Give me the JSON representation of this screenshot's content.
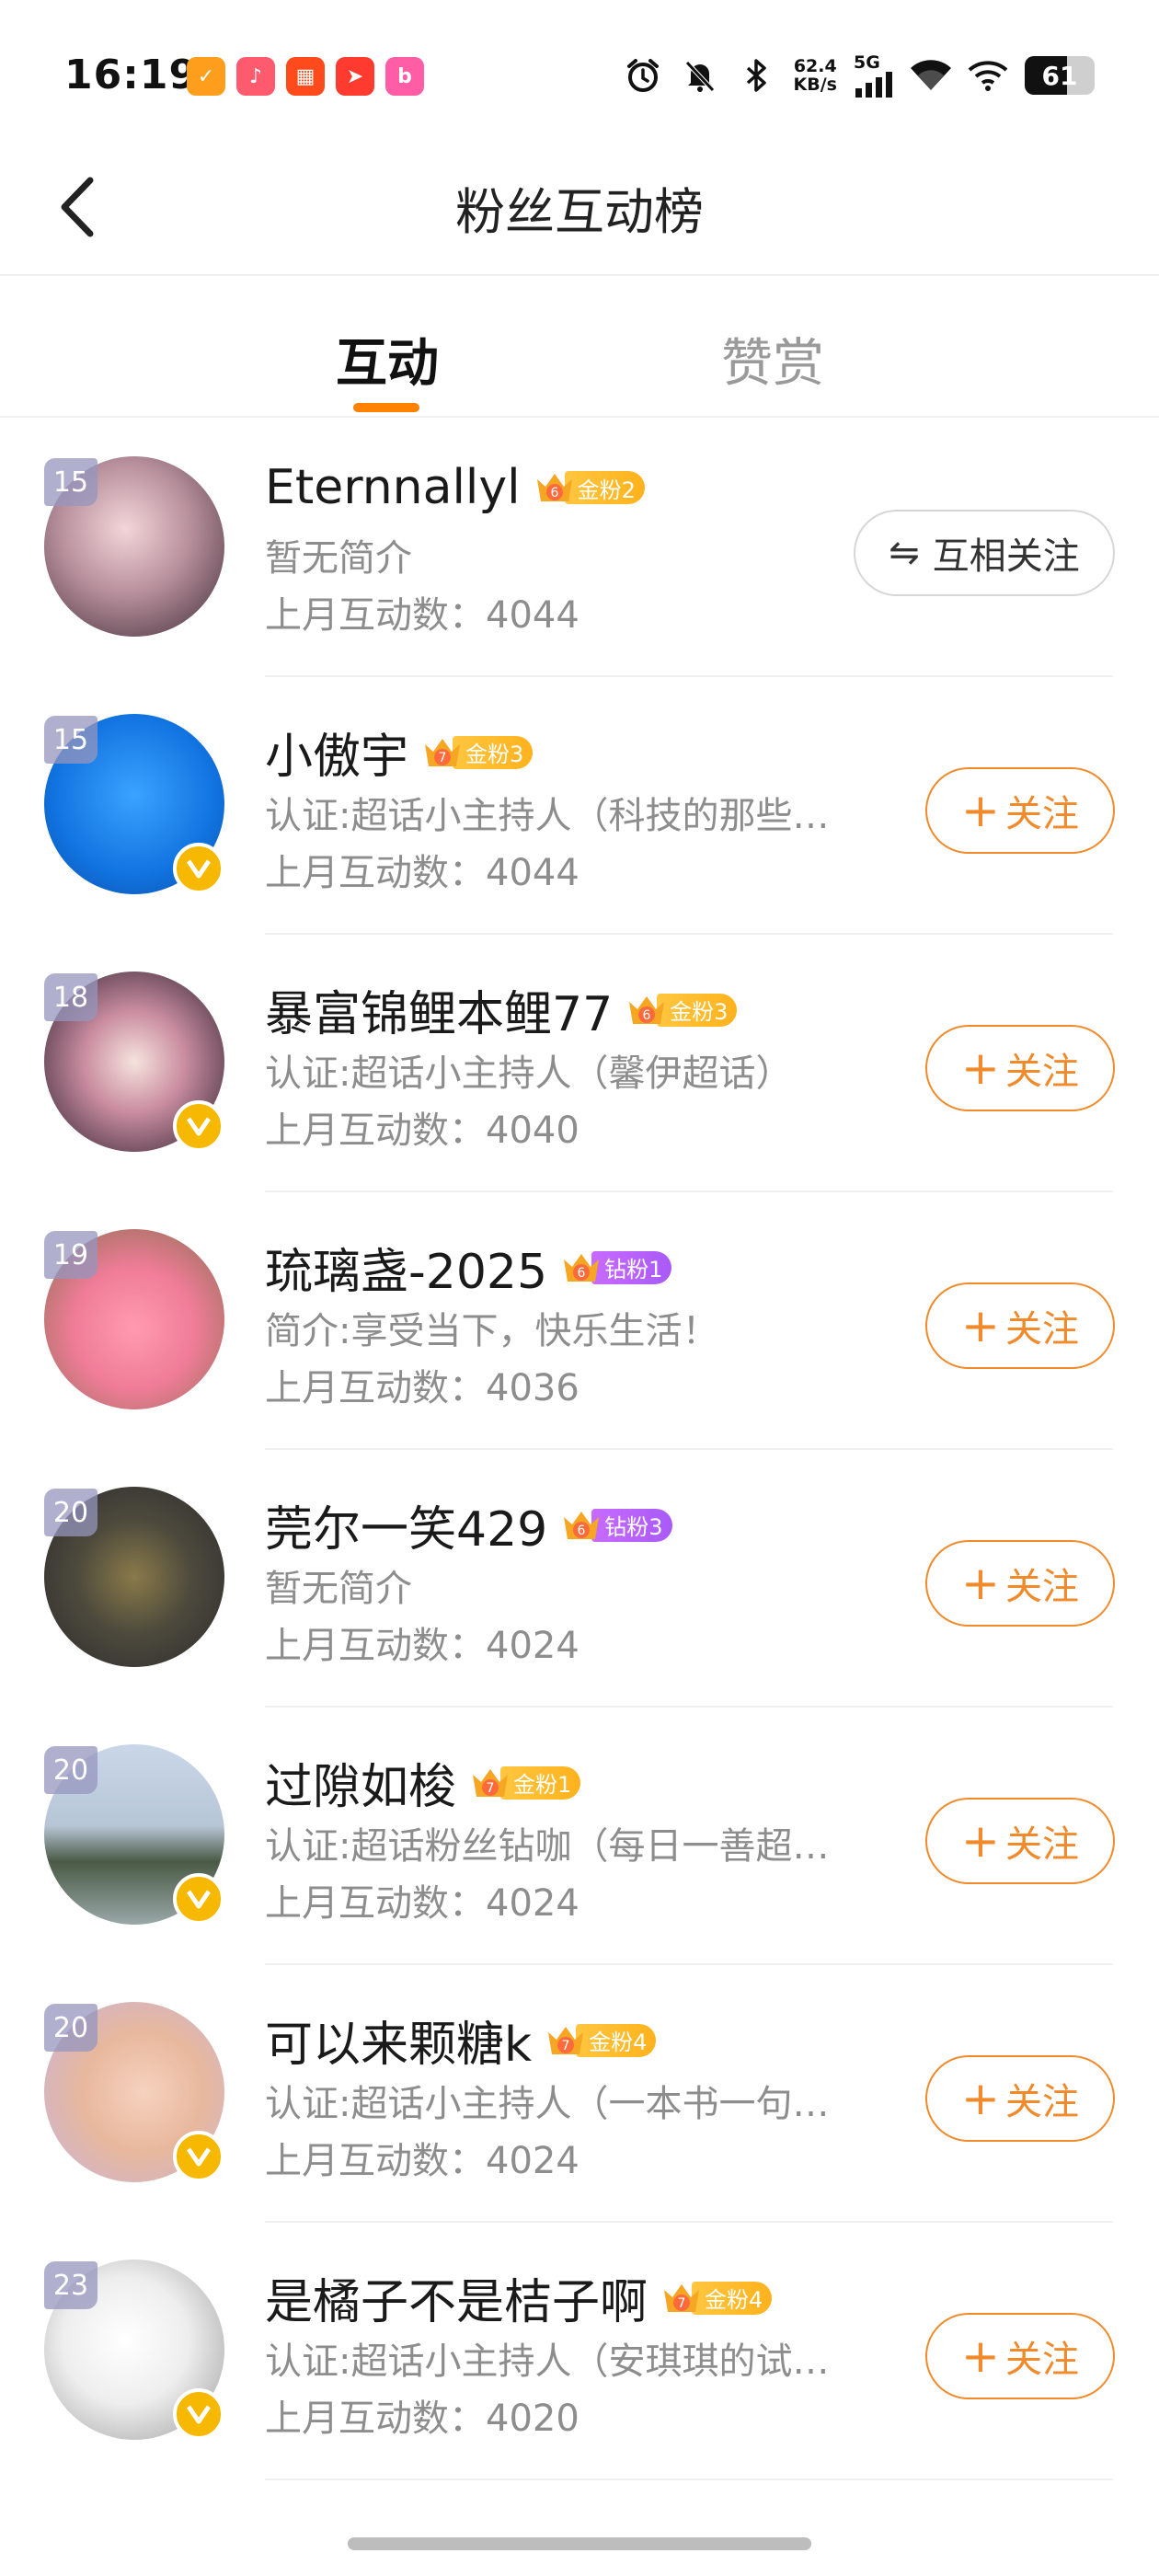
{
  "status_bar": {
    "time": "16:19",
    "net_speed_value": "62.4",
    "net_speed_unit": "KB/s",
    "network": "5G",
    "battery": "61",
    "battery_level": 0.61,
    "app_icons": [
      {
        "name": "app-icon-1",
        "color": "#ff9d1c",
        "glyph": "✓"
      },
      {
        "name": "app-icon-2",
        "color": "#ff5a6e",
        "glyph": "♪"
      },
      {
        "name": "app-icon-3",
        "color": "#ff4a1c",
        "glyph": "▦"
      },
      {
        "name": "app-icon-4",
        "color": "#ff3b30",
        "glyph": "➤"
      },
      {
        "name": "bilibili-icon",
        "color": "#ff5ea6",
        "glyph": "b"
      }
    ]
  },
  "nav": {
    "back_icon": "chevron-left-icon",
    "title": "粉丝互动榜"
  },
  "tabs": [
    {
      "label": "互动",
      "active": true
    },
    {
      "label": "赞赏",
      "active": false
    }
  ],
  "colors": {
    "accent": "#ff8200",
    "follow": "#f08a2a",
    "gold_badge": "#ffb21c",
    "diamond_badge": "#a95af7"
  },
  "users": [
    {
      "rank": "15",
      "name": "Eternnallyl",
      "badge_type": "gold",
      "badge_level": "6",
      "badge_label": "金粉2",
      "desc": "暂无简介",
      "count": "上月互动数：4044",
      "verified": false,
      "button": {
        "type": "mutual",
        "icon": "swap-icon",
        "glyph": "⇋",
        "label": "互相关注"
      },
      "avatar_bg": "radial-gradient(circle at 45% 40%, #f3d6d9 0%, #b78f9c 45%, #3b2a33 100%)"
    },
    {
      "rank": "15",
      "name": "小傲宇",
      "badge_type": "gold",
      "badge_level": "7",
      "badge_label": "金粉3",
      "desc": "认证:超话小主持人（科技的那些…",
      "count": "上月互动数：4044",
      "verified": true,
      "button": {
        "type": "follow",
        "glyph": "+",
        "label": "关注"
      },
      "avatar_bg": "radial-gradient(circle at 50% 45%, #3aa3ff 0%, #1173e0 60%, #0b4fa8 100%)"
    },
    {
      "rank": "18",
      "name": "暴富锦鲤本鲤77",
      "badge_type": "gold",
      "badge_level": "6",
      "badge_label": "金粉3",
      "desc": "认证:超话小主持人（馨伊超话）",
      "count": "上月互动数：4040",
      "verified": true,
      "button": {
        "type": "follow",
        "glyph": "+",
        "label": "关注"
      },
      "avatar_bg": "radial-gradient(circle at 50% 50%, #f6e3dc 0%, #c98ca0 40%, #2a1f2c 100%)"
    },
    {
      "rank": "19",
      "name": "琉璃盏-2025",
      "badge_type": "gold",
      "badge_level": "6",
      "badge_label": "钻粉1",
      "desc": "简介:享受当下，快乐生活！",
      "count": "上月互动数：4036",
      "verified": false,
      "button": {
        "type": "follow",
        "glyph": "+",
        "label": "关注"
      },
      "avatar_bg": "radial-gradient(circle at 50% 55%, #ff9bb0 0%, #f07c98 45%, #8a6f4e 100%)",
      "badge_variant": "diamond"
    },
    {
      "rank": "20",
      "name": "莞尔一笑429",
      "badge_type": "gold",
      "badge_level": "6",
      "badge_label": "钻粉3",
      "desc": "暂无简介",
      "count": "上月互动数：4024",
      "verified": false,
      "button": {
        "type": "follow",
        "glyph": "+",
        "label": "关注"
      },
      "avatar_bg": "radial-gradient(circle at 50% 50%, #8a7a4a 0%, #4d4a3c 45%, #2d2a2e 100%)",
      "badge_variant": "diamond"
    },
    {
      "rank": "20",
      "name": "过隙如梭",
      "badge_type": "gold",
      "badge_level": "7",
      "badge_label": "金粉1",
      "desc": "认证:超话粉丝钻咖（每日一善超…",
      "count": "上月互动数：4024",
      "verified": true,
      "button": {
        "type": "follow",
        "glyph": "+",
        "label": "关注"
      },
      "avatar_bg": "linear-gradient(180deg, #c9d7e8 0%, #b7c6d6 45%, #4a5a45 65%, #9aa8a8 100%)"
    },
    {
      "rank": "20",
      "name": "可以来颗糖k",
      "badge_type": "gold",
      "badge_level": "7",
      "badge_label": "金粉4",
      "desc": "认证:超话小主持人（一本书一句…",
      "count": "上月互动数：4024",
      "verified": true,
      "button": {
        "type": "follow",
        "glyph": "+",
        "label": "关注"
      },
      "avatar_bg": "radial-gradient(circle at 55% 50%, #f6d2bf 0%, #e8b89d 45%, #c9b3d8 100%)"
    },
    {
      "rank": "23",
      "name": "是橘子不是桔子啊",
      "badge_type": "gold",
      "badge_level": "7",
      "badge_label": "金粉4",
      "desc": "认证:超话小主持人（安琪琪的试…",
      "count": "上月互动数：4020",
      "verified": true,
      "button": {
        "type": "follow",
        "glyph": "+",
        "label": "关注"
      },
      "avatar_bg": "radial-gradient(circle at 45% 45%, #ffffff 0%, #eeeeee 45%, #9a9a9a 100%)"
    }
  ]
}
